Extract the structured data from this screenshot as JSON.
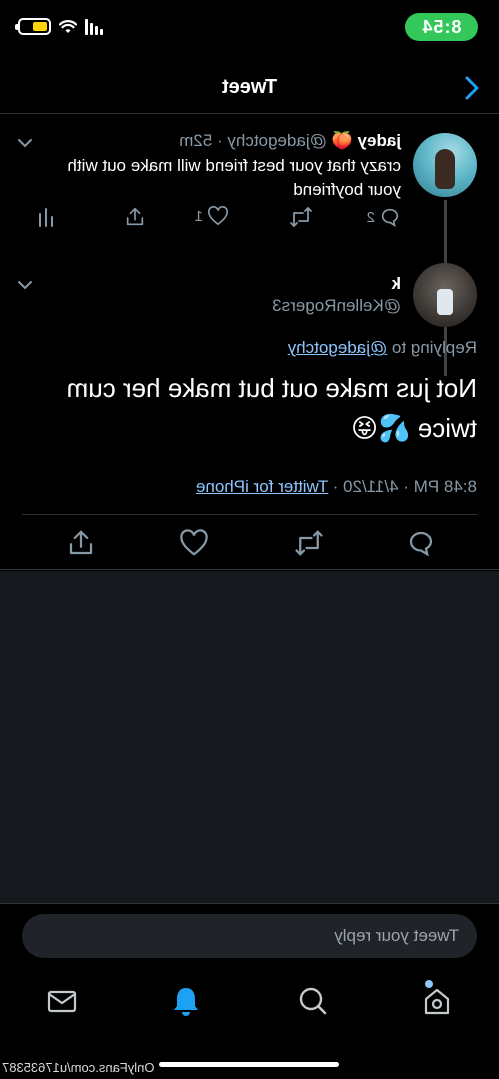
{
  "status_bar": {
    "time": "8:54"
  },
  "nav": {
    "title": "Tweet"
  },
  "parent_tweet": {
    "name": "jadey",
    "name_emoji": "🍑",
    "handle": "@jadegotchy",
    "separator": "·",
    "age": "52m",
    "text": "crazy that your best friend will make out with your boyfriend",
    "replies": "2",
    "likes": "1"
  },
  "main_tweet": {
    "name": "k",
    "handle": "@KellenRogers3",
    "replying_label": "Replying to",
    "replying_handle": "@jadegotchy",
    "text": "Not jus make out but make her cum twice",
    "emojis": "💦😝",
    "time": "8:48 PM",
    "date": "4/11/20",
    "separator": "·",
    "source": "Twitter for iPhone"
  },
  "reply": {
    "placeholder": "Tweet your reply"
  },
  "watermark": {
    "text": "OnlyFans.com/u17635387"
  },
  "colors": {
    "accent": "#1da1f2",
    "link": "#8ec6ff",
    "muted": "#8899a6",
    "status_pill": "#34c759"
  }
}
